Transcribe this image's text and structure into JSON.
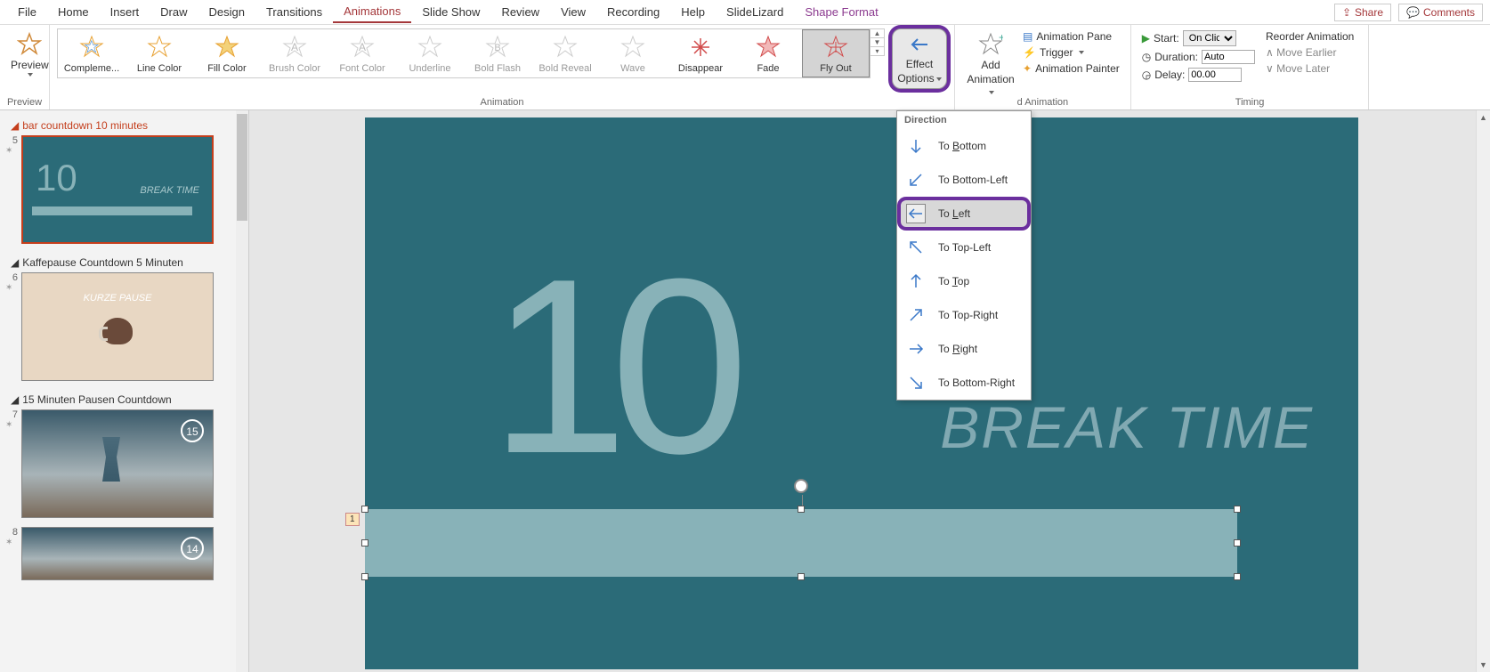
{
  "tabs": {
    "file": "File",
    "home": "Home",
    "insert": "Insert",
    "draw": "Draw",
    "design": "Design",
    "transitions": "Transitions",
    "animations": "Animations",
    "slideshow": "Slide Show",
    "review": "Review",
    "view": "View",
    "recording": "Recording",
    "help": "Help",
    "slidelizard": "SlideLizard",
    "shapeformat": "Shape Format"
  },
  "topRight": {
    "share": "Share",
    "comments": "Comments"
  },
  "ribbon": {
    "preview": "Preview",
    "previewGroup": "Preview",
    "animationGroup": "Animation",
    "advancedGroup": "d Animation",
    "timingGroup": "Timing",
    "effects": {
      "compl": "Compleme...",
      "line": "Line Color",
      "fill": "Fill Color",
      "brush": "Brush Color",
      "font": "Font Color",
      "underline": "Underline",
      "boldflash": "Bold Flash",
      "boldreveal": "Bold Reveal",
      "wave": "Wave",
      "disappear": "Disappear",
      "fade": "Fade",
      "flyout": "Fly Out"
    },
    "effectOptions": "Effect",
    "effectOptions2": "Options",
    "addAnim": "Add",
    "addAnim2": "Animation",
    "animPane": "Animation Pane",
    "trigger": "Trigger",
    "painter": "Animation Painter",
    "start": "Start:",
    "startVal": "On Click",
    "duration": "Duration:",
    "durationVal": "Auto",
    "delay": "Delay:",
    "delayVal": "00.00",
    "reorder": "Reorder Animation",
    "earlier": "Move Earlier",
    "later": "Move Later"
  },
  "dropdown": {
    "header": "Direction",
    "bottom": "To Bottom",
    "bottomleft": "To Bottom-Left",
    "left": "To Left",
    "topleft": "To Top-Left",
    "top": "To Top",
    "topright": "To Top-Right",
    "right": "To Right",
    "bottomright": "To Bottom-Right"
  },
  "sections": {
    "s1": "bar countdown 10 minutes",
    "s2": "Kaffepause Countdown 5 Minuten",
    "s3": "15 Minuten Pausen Countdown"
  },
  "thumbNums": {
    "n5": "5",
    "n6": "6",
    "n7": "7",
    "n8": "8"
  },
  "thumbBadges": {
    "b15": "15",
    "b14": "14"
  },
  "thumb1": {
    "big": "10",
    "sub": "BREAK TIME"
  },
  "thumb2": {
    "txt": "KURZE PAUSE"
  },
  "slide": {
    "big": "10",
    "sub": "BREAK TIME",
    "tag": "1"
  }
}
